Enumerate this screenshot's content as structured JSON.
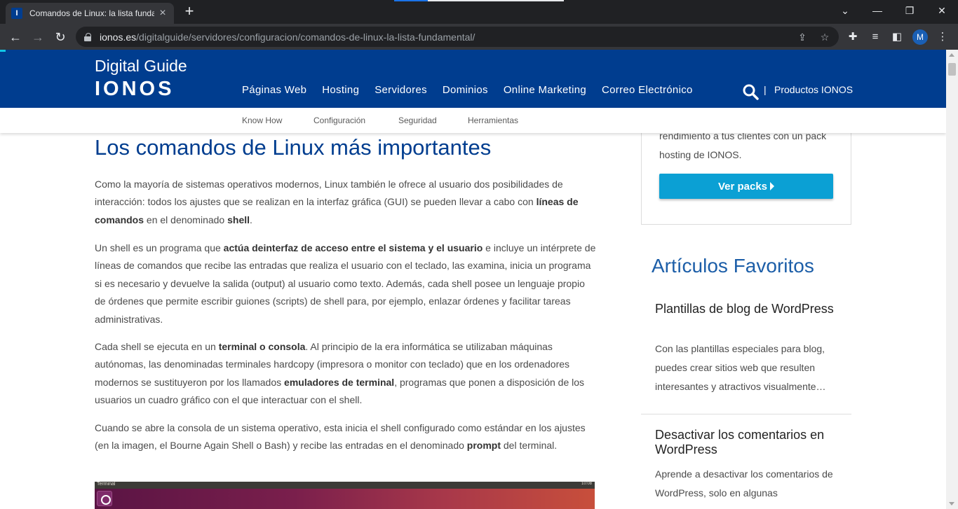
{
  "browser": {
    "tab_title": "Comandos de Linux: la lista fundamental",
    "favicon_letter": "I",
    "url_host": "ionos.es",
    "url_path": "/digitalguide/servidores/configuracion/comandos-de-linux-la-lista-fundamental/",
    "profile_initial": "M"
  },
  "header": {
    "brand_top": "Digital Guide",
    "brand_bottom": "IONOS",
    "nav": [
      "Páginas Web",
      "Hosting",
      "Servidores",
      "Dominios",
      "Online Marketing",
      "Correo Electrónico"
    ],
    "separator": "|",
    "productos": "Productos IONOS"
  },
  "subnav": [
    "Know How",
    "Configuración",
    "Seguridad",
    "Herramientas"
  ],
  "article": {
    "title": "Los comandos de Linux más importantes",
    "p1": {
      "t1": "Como la mayoría de sistemas operativos modernos, Linux también le ofrece al usuario dos posibilidades de interacción: todos los ajustes que se realizan en la interfaz gráfica (GUI) se pueden llevar a cabo con ",
      "b1": "líneas de comandos",
      "t2": " en el denominado ",
      "b2": "shell",
      "t3": "."
    },
    "p2": {
      "t1": "Un shell es un programa que ",
      "b1": "actúa deinterfaz de acceso entre el sistema y el usuario",
      "t2": " e incluye un intérprete de líneas de comandos que recibe las entradas que realiza el usuario con el teclado, las examina, inicia un programa si es necesario y devuelve la salida (output) al usuario como texto. Además, cada shell posee un lenguaje propio de órdenes que permite escribir guiones (scripts) de shell para, por ejemplo, enlazar órdenes y facilitar tareas administrativas."
    },
    "p3": {
      "t1": "Cada shell se ejecuta en un ",
      "b1": "terminal o consola",
      "t2": ". Al principio de la era informática se utilizaban máquinas autónomas, las denominadas terminales hardcopy (impresora o monitor con teclado) que en los ordenadores modernos se sustituyeron por los llamados ",
      "b2": "emuladores de terminal",
      "t3": ", programas que ponen a disposición de los usuarios un cuadro gráfico con el que interactuar con el shell."
    },
    "p4": {
      "t1": "Cuando se abre la consola de un sistema operativo, esta inicia el shell configurado como estándar en los ajustes (en la imagen, el Bourne Again Shell o Bash) y recibe las entradas en el denominado ",
      "b1": "prompt",
      "t2": " del terminal."
    },
    "terminal_bar_title": "Terminal",
    "terminal_bar_time": "10:08"
  },
  "sidebar": {
    "promo_text": "rendimiento a tus clientes con un pack hosting de IONOS.",
    "promo_button": "Ver packs",
    "favorites_heading": "Artículos Favoritos",
    "favorites": [
      {
        "title": "Plantillas de blog de WordPress",
        "excerpt": "Con las plantillas especiales para blog, puedes crear sitios web que resulten interesantes y atractivos visualmente…"
      },
      {
        "title": "Desactivar los comentarios en WordPress",
        "excerpt": "Aprende a desactivar los comentarios de WordPress, solo en algunas"
      }
    ]
  },
  "colors": {
    "brand_blue": "#003d8f",
    "accent_cyan": "#0ba0d4",
    "heading_blue": "#1c5ea8"
  }
}
